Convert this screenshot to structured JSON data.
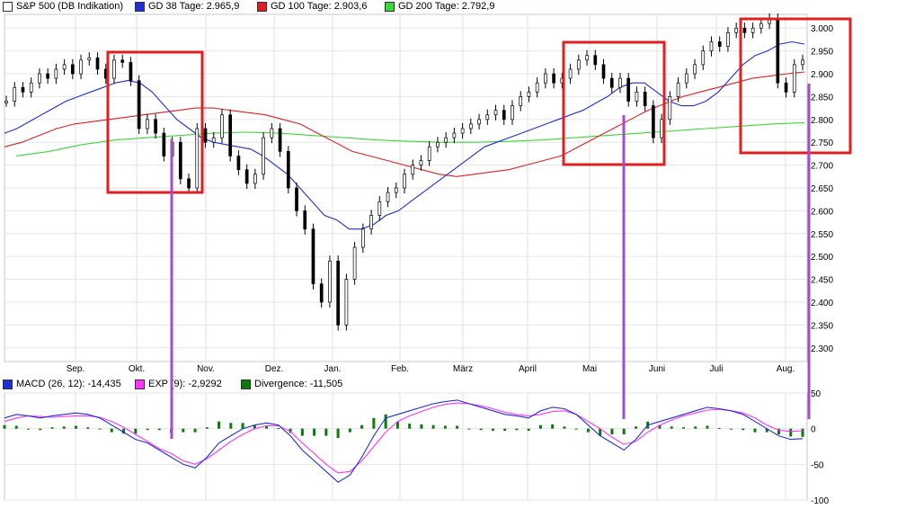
{
  "price_legend": [
    {
      "label": "S&P 500 (DB Indikation)",
      "color": "#ffffff"
    },
    {
      "label": "GD 38 Tage: 2.965,9",
      "color": "#1f2fd6"
    },
    {
      "label": "GD 100 Tage: 2.903,6",
      "color": "#e02020"
    },
    {
      "label": "GD 200 Tage: 2.792,9",
      "color": "#39d839"
    }
  ],
  "macd_legend": [
    {
      "label": "MACD (26, 12): -14,435",
      "color": "#1f2fd6"
    },
    {
      "label": "EXP (9): -2,9292",
      "color": "#ff33ff"
    },
    {
      "label": "Divergence: -11,505",
      "color": "#0a7a0a"
    }
  ],
  "chart_data": [
    {
      "type": "line",
      "title": "S&P 500 (DB Indikation)",
      "x_labels": [
        "Sep.",
        "Okt.",
        "Nov.",
        "Dez.",
        "Jan.",
        "Feb.",
        "März",
        "April",
        "Mai",
        "Juni",
        "Juli",
        "Aug."
      ],
      "y_ticks": [
        "3.000",
        "2.950",
        "2.900",
        "2.850",
        "2.800",
        "2.750",
        "2.700",
        "2.650",
        "2.600",
        "2.550",
        "2.500",
        "2.450",
        "2.400",
        "2.350",
        "2.300"
      ],
      "ylim": [
        2270,
        3030
      ],
      "series": [
        {
          "name": "S&P 500 (DB Indikation)",
          "color": "#000000",
          "values": [
            2840,
            2870,
            2860,
            2880,
            2900,
            2890,
            2910,
            2920,
            2900,
            2930,
            2935,
            2910,
            2890,
            2930,
            2925,
            2885,
            2780,
            2800,
            2770,
            2720,
            2750,
            2670,
            2650,
            2780,
            2750,
            2760,
            2810,
            2720,
            2690,
            2660,
            2680,
            2760,
            2780,
            2730,
            2650,
            2600,
            2560,
            2440,
            2400,
            2490,
            2350,
            2450,
            2520,
            2560,
            2590,
            2620,
            2640,
            2650,
            2680,
            2700,
            2710,
            2740,
            2750,
            2760,
            2770,
            2780,
            2790,
            2800,
            2810,
            2820,
            2800,
            2830,
            2850,
            2860,
            2880,
            2900,
            2880,
            2890,
            2910,
            2930,
            2940,
            2920,
            2890,
            2870,
            2890,
            2840,
            2860,
            2830,
            2760,
            2800,
            2850,
            2880,
            2900,
            2920,
            2950,
            2970,
            2960,
            2990,
            3000,
            2990,
            3000,
            3010,
            3020,
            2880,
            2860,
            2920,
            2930
          ]
        },
        {
          "name": "GD 38 Tage",
          "color": "#1f2fd6",
          "values": [
            2770,
            2780,
            2795,
            2810,
            2825,
            2840,
            2850,
            2860,
            2870,
            2880,
            2885,
            2880,
            2860,
            2830,
            2800,
            2780,
            2760,
            2750,
            2745,
            2740,
            2735,
            2720,
            2700,
            2680,
            2650,
            2620,
            2590,
            2580,
            2560,
            2560,
            2570,
            2590,
            2600,
            2620,
            2640,
            2660,
            2680,
            2700,
            2720,
            2740,
            2750,
            2760,
            2770,
            2780,
            2790,
            2800,
            2810,
            2820,
            2835,
            2850,
            2870,
            2880,
            2880,
            2860,
            2840,
            2830,
            2830,
            2840,
            2860,
            2890,
            2920,
            2940,
            2950,
            2965,
            2970,
            2965
          ]
        },
        {
          "name": "GD 100 Tage",
          "color": "#e02020",
          "values": [
            2740,
            2750,
            2765,
            2780,
            2790,
            2795,
            2800,
            2805,
            2810,
            2815,
            2820,
            2825,
            2825,
            2820,
            2815,
            2810,
            2800,
            2790,
            2770,
            2750,
            2730,
            2720,
            2710,
            2700,
            2690,
            2680,
            2675,
            2680,
            2685,
            2690,
            2700,
            2710,
            2720,
            2740,
            2760,
            2780,
            2800,
            2820,
            2835,
            2850,
            2860,
            2870,
            2880,
            2890,
            2895,
            2900,
            2904
          ]
        },
        {
          "name": "GD 200 Tage",
          "color": "#39d839",
          "values": [
            2720,
            2730,
            2745,
            2755,
            2760,
            2765,
            2770,
            2772,
            2770,
            2765,
            2760,
            2755,
            2752,
            2750,
            2750,
            2752,
            2755,
            2760,
            2765,
            2770,
            2775,
            2780,
            2785,
            2790,
            2793
          ]
        }
      ]
    },
    {
      "type": "line",
      "title": "MACD",
      "y_ticks": [
        "50",
        "0",
        "-50",
        "-100"
      ],
      "ylim": [
        -100,
        50
      ],
      "series": [
        {
          "name": "MACD (26, 12)",
          "color": "#1f2fd6",
          "values": [
            15,
            20,
            18,
            15,
            18,
            20,
            22,
            20,
            15,
            5,
            -5,
            -15,
            -20,
            -30,
            -40,
            -50,
            -55,
            -40,
            -20,
            -10,
            0,
            5,
            8,
            5,
            -10,
            -30,
            -45,
            -60,
            -75,
            -65,
            -40,
            -10,
            15,
            20,
            25,
            30,
            35,
            38,
            40,
            35,
            30,
            25,
            20,
            18,
            15,
            25,
            30,
            28,
            20,
            5,
            -10,
            -20,
            -30,
            -15,
            5,
            10,
            15,
            20,
            25,
            30,
            28,
            25,
            20,
            10,
            0,
            -10,
            -15,
            -14
          ]
        },
        {
          "name": "EXP (9)",
          "color": "#ff33ff",
          "values": [
            10,
            15,
            18,
            17,
            16,
            17,
            18,
            18,
            16,
            10,
            2,
            -8,
            -18,
            -28,
            -35,
            -45,
            -50,
            -42,
            -30,
            -18,
            -8,
            0,
            4,
            4,
            -4,
            -20,
            -35,
            -50,
            -62,
            -60,
            -45,
            -25,
            -5,
            10,
            18,
            24,
            30,
            34,
            36,
            35,
            32,
            28,
            23,
            20,
            18,
            20,
            24,
            25,
            20,
            10,
            0,
            -12,
            -22,
            -18,
            -5,
            5,
            12,
            18,
            22,
            26,
            27,
            25,
            22,
            15,
            5,
            -2,
            -4,
            -3
          ]
        },
        {
          "name": "Divergence",
          "color": "#0a7a0a",
          "values": [
            5,
            4,
            0,
            -2,
            2,
            3,
            4,
            2,
            -1,
            -5,
            -7,
            -7,
            -2,
            -2,
            -5,
            -5,
            -5,
            2,
            10,
            8,
            8,
            5,
            4,
            1,
            -6,
            -10,
            -10,
            -10,
            -13,
            -5,
            5,
            15,
            20,
            10,
            7,
            6,
            5,
            4,
            4,
            0,
            -2,
            -3,
            -3,
            -2,
            -3,
            5,
            6,
            3,
            0,
            -5,
            -10,
            -8,
            -8,
            3,
            10,
            5,
            3,
            2,
            3,
            4,
            1,
            0,
            -2,
            -5,
            -5,
            -8,
            -11,
            -11.5
          ]
        }
      ]
    }
  ],
  "annotations": {
    "box_color": "#e02020",
    "line_color": "#a44ccc"
  }
}
